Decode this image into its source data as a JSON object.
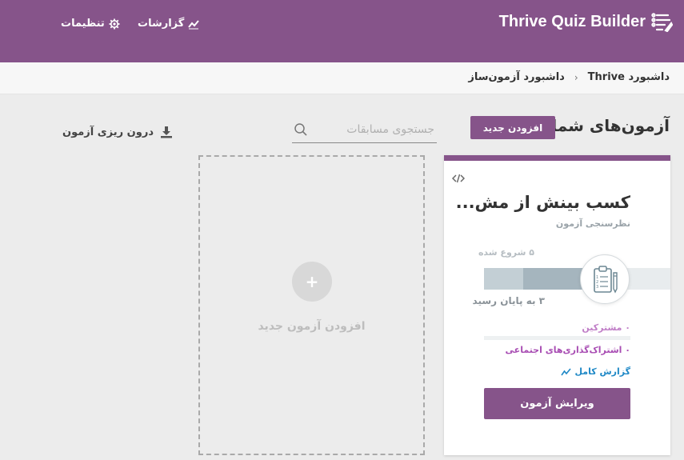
{
  "header": {
    "brand": "Thrive Quiz Builder",
    "reports_label": "گزارشات",
    "settings_label": "تنظیمات"
  },
  "breadcrumb": {
    "items": [
      "داشبورد Thrive",
      "داشبورد آزمون‌ساز"
    ],
    "separator": "‹"
  },
  "toolbar": {
    "page_title": "آزمون‌های شما",
    "add_new_label": "افزودن جدید",
    "search_placeholder": "جستجوی مسابقات",
    "import_label": "درون ریزی آزمون"
  },
  "add_card": {
    "plus": "+",
    "label": "افزودن آزمون جدید"
  },
  "quiz_card": {
    "title": "کسب بینش از مش...",
    "type": "نظرسنجی آزمون",
    "started_text": "۵ شروع شده",
    "completed_text": "۳ به پایان رسید",
    "subscribers_text": "۰ مشترکین",
    "social_text": "۰ اشتراک‌گذاری‌های اجتماعی",
    "report_label": "گزارش کامل",
    "edit_label": "ویرایش آزمون"
  },
  "colors": {
    "brand_purple": "#86548a",
    "link_blue": "#1e88c6",
    "subscriber_pink": "#c07ec7"
  },
  "icons": [
    "list-logo-icon",
    "trend-icon",
    "gear-icon",
    "search-icon",
    "download-icon",
    "code-icon",
    "clipboard-icon",
    "plus-icon"
  ]
}
